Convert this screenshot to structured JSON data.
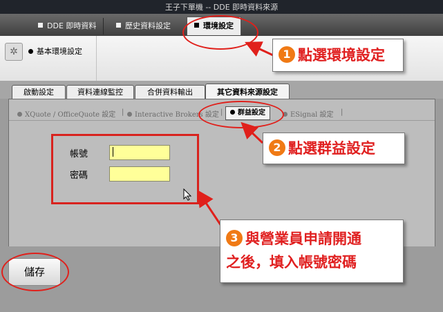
{
  "titlebar": {
    "title": "王子下單機  --  DDE  即時資料來源"
  },
  "menubar": {
    "tabs": [
      {
        "label": "DDE 即時資料"
      },
      {
        "label": "歷史資料設定"
      },
      {
        "label": "環境設定"
      }
    ]
  },
  "toolbar": {
    "group_label": "基本環境設定"
  },
  "subtabs": [
    "啟動設定",
    "資料連線監控",
    "合併資料輸出",
    "其它資料來源設定"
  ],
  "providers": [
    {
      "label": "XQuote / OfficeQuote 設定"
    },
    {
      "label": "Interactive Brokers 設定"
    },
    {
      "label": "群益設定"
    },
    {
      "label": "ESignal 設定"
    }
  ],
  "form": {
    "account_label": "帳號",
    "password_label": "密碼",
    "account_value": "",
    "password_value": ""
  },
  "save_label": "儲存",
  "annotations": {
    "step1": {
      "num": "1",
      "text": "點選環境設定"
    },
    "step2": {
      "num": "2",
      "text": "點選群益設定"
    },
    "step3": {
      "num": "3",
      "line1": "與營業員申請開通",
      "line2": "之後，填入帳號密碼"
    }
  },
  "colors": {
    "annotation_red": "#e0201b",
    "input_yellow": "#ffff99",
    "badge_orange": "#f07a15"
  }
}
